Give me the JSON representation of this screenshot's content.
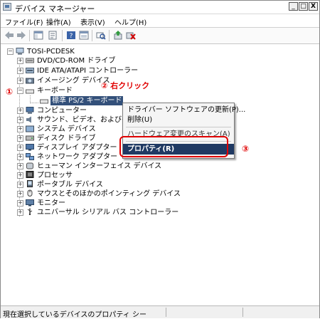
{
  "window": {
    "title": "デバイス マネージャー"
  },
  "caption_buttons": {
    "minimize": "_",
    "maximize": "□",
    "close": "X"
  },
  "menu": [
    "ファイル(F)",
    "操作(A)",
    "表示(V)",
    "ヘルプ(H)"
  ],
  "toolbar_icons": [
    "back-arrow-icon",
    "forward-arrow-icon",
    "show-hide-tree-icon",
    "properties-icon",
    "help-icon",
    "view-icon",
    "scan-hardware-icon",
    "update-driver-icon",
    "uninstall-icon"
  ],
  "tree": {
    "root": "TOSI-PCDESK",
    "items": [
      "DVD/CD-ROM ドライブ",
      "IDE ATA/ATAPI コントローラー",
      "イメージング デバイス",
      "キーボード",
      "標準 PS/2 キーボード",
      "コンピューター",
      "サウンド、ビデオ、およびゲー",
      "システム デバイス",
      "ディスク ドライブ",
      "ディスプレイ アダプター",
      "ネットワーク アダプター",
      "ヒューマン インターフェイス デバイス",
      "プロセッサ",
      "ポータブル デバイス",
      "マウスとそのほかのポインティング デバイス",
      "モニター",
      "ユニバーサル シリアル バス コントローラー"
    ]
  },
  "context_menu": {
    "items": [
      "ドライバー ソフトウェアの更新(P)...",
      "削除(U)",
      "ハードウェア変更のスキャン(A)",
      "プロパティ(R)"
    ]
  },
  "annotations": {
    "step1": "①",
    "step2": "② 右クリック",
    "step3": "③"
  },
  "status": {
    "text": "現在選択しているデバイスのプロパティ シー"
  }
}
